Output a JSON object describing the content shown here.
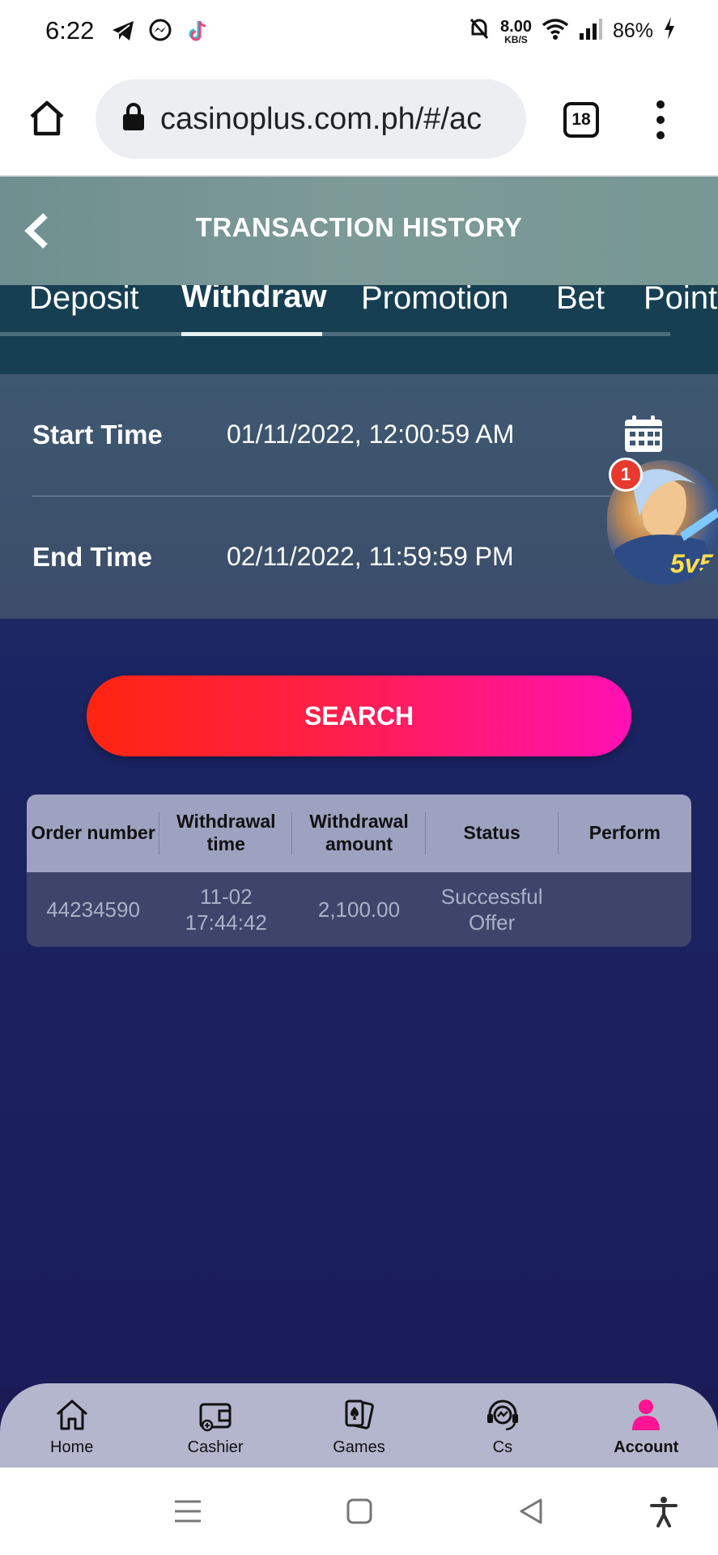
{
  "status_bar": {
    "time": "6:22",
    "speed_value": "8.00",
    "speed_unit": "KB/S",
    "battery": "86%"
  },
  "browser": {
    "url": "casinoplus.com.ph/#/ac",
    "tab_count": "18"
  },
  "header": {
    "title": "TRANSACTION HISTORY"
  },
  "tabs": [
    {
      "label": "Deposit",
      "active": false
    },
    {
      "label": "Withdraw",
      "active": true
    },
    {
      "label": "Promotion",
      "active": false
    },
    {
      "label": "Bet",
      "active": false
    },
    {
      "label": "Point",
      "active": false
    }
  ],
  "filter": {
    "start_label": "Start Time",
    "start_value": "01/11/2022, 12:00:59 AM",
    "end_label": "End Time",
    "end_value": "02/11/2022, 11:59:59 PM"
  },
  "floating": {
    "badge": "1",
    "label": "5v5"
  },
  "search": {
    "label": "SEARCH"
  },
  "table": {
    "headers": [
      "Order number",
      "Withdrawal time",
      "Withdrawal amount",
      "Status",
      "Perform"
    ],
    "rows": [
      [
        "44234590",
        "11-02 17:44:42",
        "2,100.00",
        "Successful Offer",
        ""
      ]
    ]
  },
  "bottom_nav": [
    {
      "label": "Home",
      "icon": "home-icon"
    },
    {
      "label": "Cashier",
      "icon": "wallet-icon"
    },
    {
      "label": "Games",
      "icon": "cards-icon"
    },
    {
      "label": "Cs",
      "icon": "headset-icon"
    },
    {
      "label": "Account",
      "icon": "account-icon",
      "active": true
    }
  ],
  "colors": {
    "search_gradient_start": "#ff2510",
    "search_gradient_end": "#ff10b4",
    "account_accent": "#ff1493"
  }
}
